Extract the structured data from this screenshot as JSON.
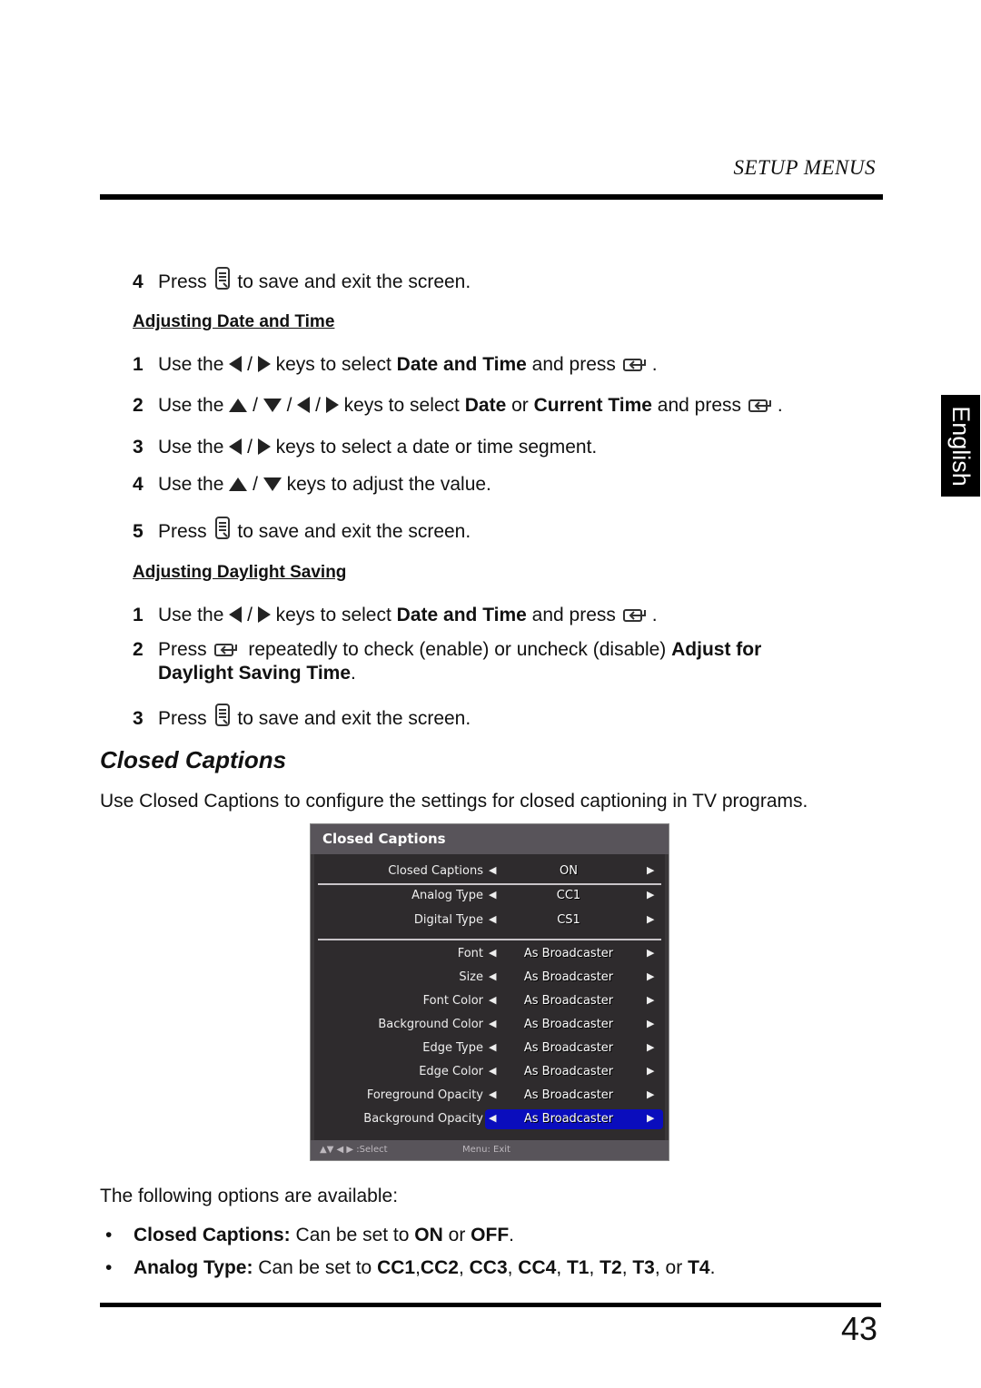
{
  "header": {
    "section_title": "SETUP MENUS"
  },
  "side_tab": {
    "language": "English"
  },
  "intro_step": {
    "num": "4",
    "pre": "Press",
    "post": "to save and exit the screen."
  },
  "date_time": {
    "heading": "Adjusting Date and Time",
    "steps": [
      {
        "num": "1",
        "t1": "Use the",
        "t2": "/",
        "t3": "keys to select",
        "b1": "Date and Time",
        "t4": "and press",
        "t5": "."
      },
      {
        "num": "2",
        "t1": "Use the",
        "sep": "/",
        "t3": "keys to select",
        "b1": "Date",
        "t4": "or",
        "b2": "Current Time",
        "t5": "and press",
        "t6": "."
      },
      {
        "num": "3",
        "t1": "Use the",
        "t2": "/",
        "t3": "keys to select a date or time segment."
      },
      {
        "num": "4",
        "t1": "Use the",
        "t2": "/",
        "t3": "keys to adjust the value."
      },
      {
        "num": "5",
        "pre": "Press",
        "post": "to save and exit the screen."
      }
    ]
  },
  "daylight": {
    "heading": "Adjusting Daylight Saving",
    "steps": [
      {
        "num": "1",
        "t1": "Use the",
        "t2": "/",
        "t3": "keys to select",
        "b1": "Date and Time",
        "t4": "and press",
        "t5": "."
      },
      {
        "num": "2",
        "pre": "Press",
        "t1": "repeatedly to check (enable) or uncheck (disable)",
        "b1": "Adjust for",
        "b2": "Daylight Saving Time",
        "t2": "."
      },
      {
        "num": "3",
        "pre": "Press",
        "post": "to save and exit the screen."
      }
    ]
  },
  "closed_captions": {
    "title": "Closed Captions",
    "description": "Use Closed Captions to configure the settings for closed captioning in TV programs.",
    "osd": {
      "title": "Closed Captions",
      "rows": [
        {
          "label": "Closed Captions",
          "value": "ON"
        },
        {
          "label": "Analog Type",
          "value": "CC1"
        },
        {
          "label": "Digital Type",
          "value": "CS1"
        },
        {
          "label": "Font",
          "value": "As Broadcaster"
        },
        {
          "label": "Size",
          "value": "As Broadcaster"
        },
        {
          "label": "Font Color",
          "value": "As Broadcaster"
        },
        {
          "label": "Background Color",
          "value": "As Broadcaster"
        },
        {
          "label": "Edge Type",
          "value": "As Broadcaster"
        },
        {
          "label": "Edge Color",
          "value": "As Broadcaster"
        },
        {
          "label": "Foreground Opacity",
          "value": "As Broadcaster"
        },
        {
          "label": "Background Opacity",
          "value": "As Broadcaster",
          "selected": true
        }
      ],
      "footer_select": "▲▼ ◀ ▶ :Select",
      "footer_exit": "Menu: Exit",
      "highlight_color": "#0a0dbd"
    },
    "options_intro": "The following options are available:",
    "options": [
      {
        "name": "Closed Captions:",
        "text": "Can be set to",
        "v1": "ON",
        "or": "or",
        "v2": "OFF",
        "end": "."
      },
      {
        "name": "Analog Type:",
        "text": "Can be set to",
        "vals": [
          "CC1",
          "CC2",
          "CC3",
          "CC4",
          "T1",
          "T2",
          "T3"
        ],
        "or": "or",
        "last": "T4",
        "end": "."
      }
    ]
  },
  "footer": {
    "page_number": "43"
  }
}
